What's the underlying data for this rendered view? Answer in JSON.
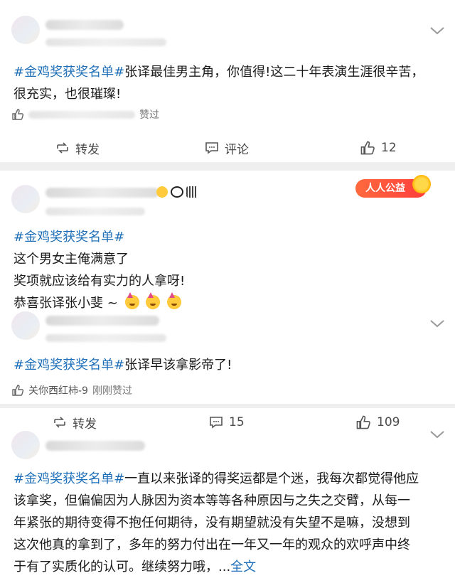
{
  "posts": [
    {
      "id": "post-1",
      "tag": "#金鸡奖获奖名单#",
      "lines": [
        "张译最佳男主角，你值得!这二十年表演生涯很辛苦，",
        "很充实，也很璀璨!"
      ],
      "liked_suffix": "赞过",
      "actions": {
        "repost": "转发",
        "comment": "评论",
        "like": "12"
      }
    },
    {
      "id": "post-2",
      "badge": "人人公益",
      "tag": "#金鸡奖获奖名单#",
      "lines": [
        "这个男女主俺满意了",
        "奖项就应该给有实力的人拿呀!",
        "恭喜张译张小斐 ~"
      ]
    },
    {
      "id": "post-3",
      "tag": "#金鸡奖获奖名单#",
      "text": "张译早该拿影帝了!",
      "liked_by": "关你西红柿-9",
      "liked_time": "刚刚赞过",
      "actions": {
        "repost": "转发",
        "comment": "15",
        "like": "109"
      }
    },
    {
      "id": "post-4",
      "tag": "#金鸡奖获奖名单#",
      "first_line": "一直以来张译的得奖运都是个迷，我每次都觉得他应",
      "lines": [
        "该拿奖，但偏偏因为人脉因为资本等等各种原因与之失之交臂，从每一",
        "年紧张的期待变得不抱任何期待，没有期望就没有失望不是嘛，没想到",
        "这次他真的拿到了，多年的努力付出在一年又一年的观众的欢呼声中终"
      ],
      "last_line": "于有了实质化的认可。继续努力哦，...",
      "more": "全文"
    }
  ],
  "colors": {
    "tag": "#1e6fb8",
    "separator": "#efefef",
    "badge": "#ff4a3d"
  },
  "icons": {
    "chevron": "chevron-down-icon",
    "repost": "repost-icon",
    "comment": "comment-icon",
    "like": "thumbs-up-icon"
  }
}
